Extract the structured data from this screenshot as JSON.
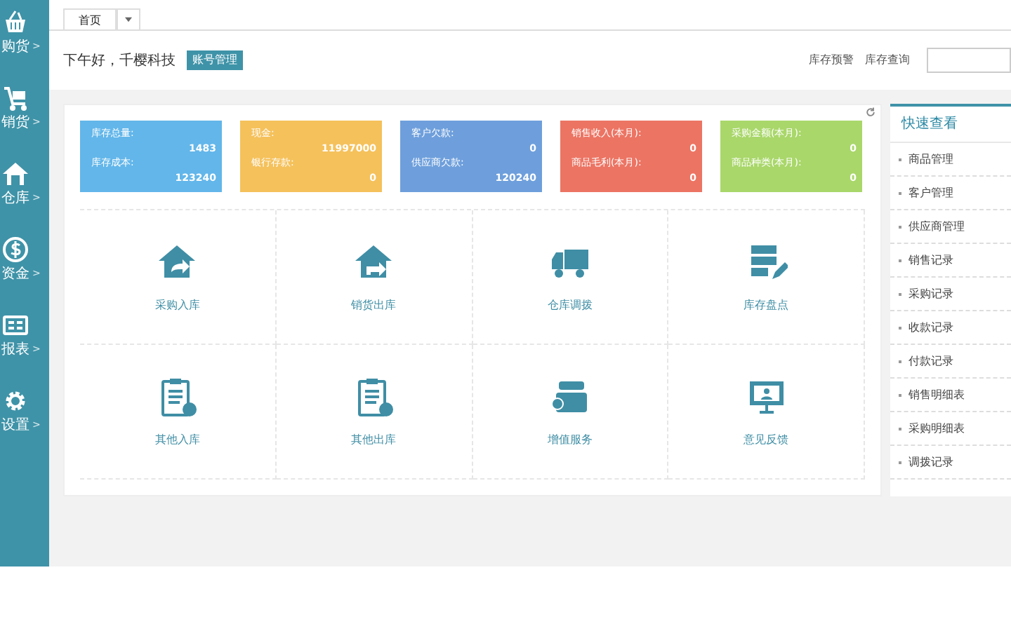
{
  "sidebar": {
    "items": [
      {
        "label": "购货"
      },
      {
        "label": "销货"
      },
      {
        "label": "仓库"
      },
      {
        "label": "资金"
      },
      {
        "label": "报表"
      },
      {
        "label": "设置"
      }
    ],
    "arrow": ">"
  },
  "tabs": [
    {
      "label": "首页",
      "selected": true
    }
  ],
  "header": {
    "greeting": "下午好，千樱科技",
    "account_button": "账号管理",
    "links": [
      "库存预警",
      "库存查询"
    ]
  },
  "stats": [
    {
      "color": "#62b6ea",
      "rows": [
        {
          "label": "库存总量:",
          "value": "1483"
        },
        {
          "label": "库存成本:",
          "value": "123240"
        }
      ]
    },
    {
      "color": "#f5c15b",
      "rows": [
        {
          "label": "现金:",
          "value": "11997000"
        },
        {
          "label": "银行存款:",
          "value": "0"
        }
      ]
    },
    {
      "color": "#6e9fdc",
      "rows": [
        {
          "label": "客户欠款:",
          "value": "0"
        },
        {
          "label": "供应商欠款:",
          "value": "120240"
        }
      ]
    },
    {
      "color": "#ec7463",
      "rows": [
        {
          "label": "销售收入(本月):",
          "value": "0"
        },
        {
          "label": "商品毛利(本月):",
          "value": "0"
        }
      ]
    },
    {
      "color": "#a9d76a",
      "rows": [
        {
          "label": "采购金额(本月):",
          "value": "0"
        },
        {
          "label": "商品种类(本月):",
          "value": "0"
        }
      ]
    }
  ],
  "actions": [
    {
      "label": "采购入库"
    },
    {
      "label": "销货出库"
    },
    {
      "label": "仓库调拨"
    },
    {
      "label": "库存盘点"
    },
    {
      "label": "其他入库"
    },
    {
      "label": "其他出库"
    },
    {
      "label": "增值服务"
    },
    {
      "label": "意见反馈"
    }
  ],
  "quick_view": {
    "title": "快速查看",
    "items": [
      "商品管理",
      "客户管理",
      "供应商管理",
      "销售记录",
      "采购记录",
      "收款记录",
      "付款记录",
      "销售明细表",
      "采购明细表",
      "调拨记录"
    ]
  }
}
